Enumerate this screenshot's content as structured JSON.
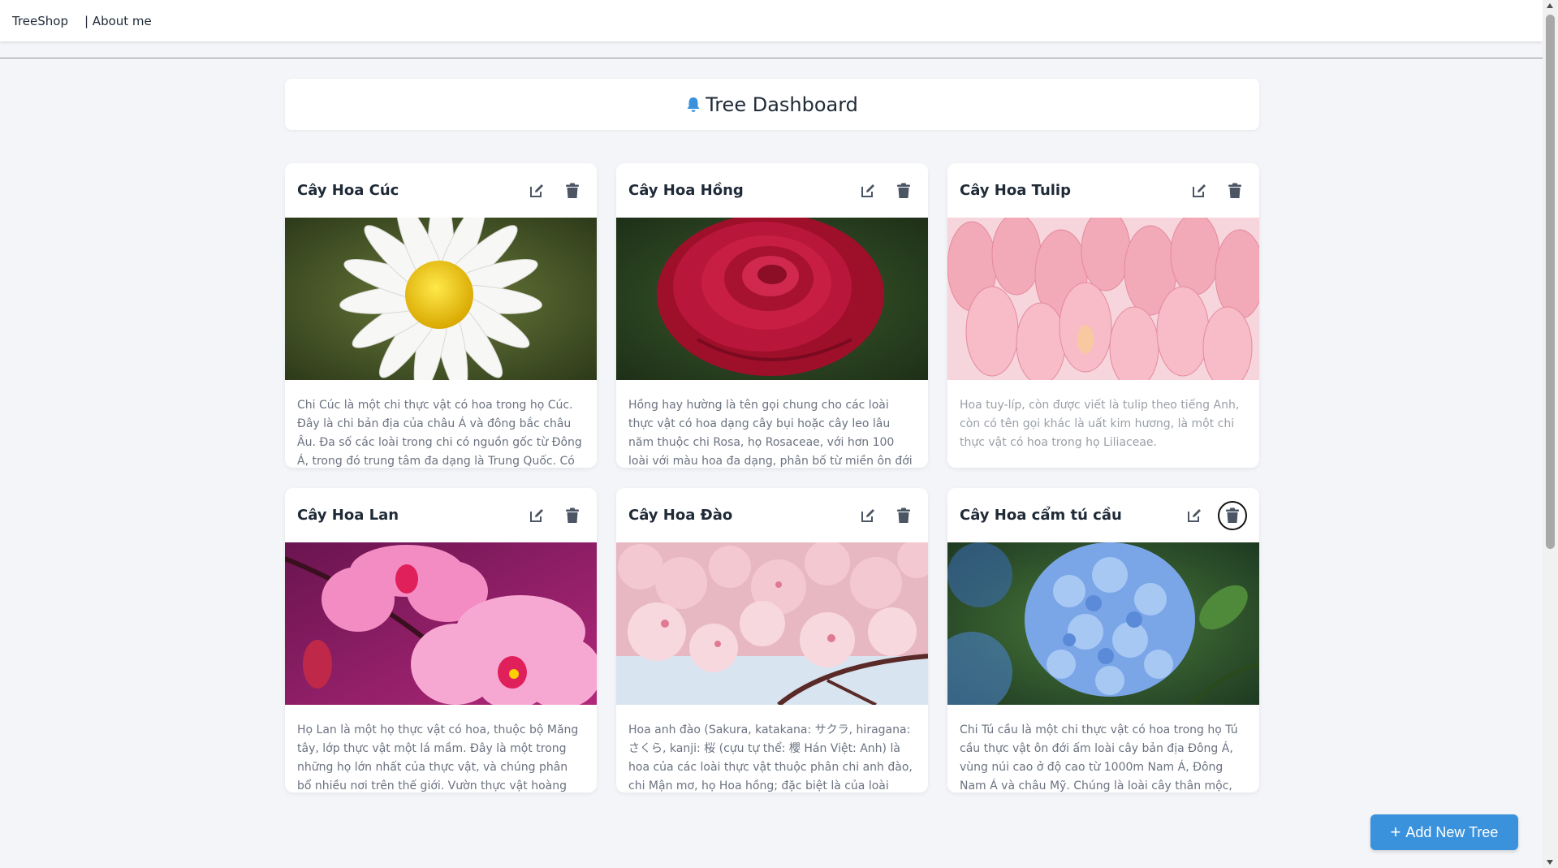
{
  "navbar": {
    "brand": "TreeShop",
    "about": "| About me"
  },
  "dashboard": {
    "title": "Tree Dashboard",
    "title_icon": "bell-icon"
  },
  "cards": [
    {
      "title": "Cây Hoa Cúc",
      "image": "white-daisy",
      "description": "Chi Cúc là một chi thực vật có hoa trong họ Cúc. Đây là chi bản địa của châu Á và đông bắc châu Âu. Đa số các loài trong chi có nguồn gốc từ Đông Á, trong đó trung tâm đa dạng là Trung Quốc. Có"
    },
    {
      "title": "Cây Hoa Hồng",
      "image": "red-rose",
      "description": "Hồng hay hường là tên gọi chung cho các loài thực vật có hoa dạng cây bụi hoặc cây leo lâu năm thuộc chi Rosa, họ Rosaceae, với hơn 100 loài với màu hoa đa dạng, phân bố từ miền ôn đới đến nhiệt đới. Các"
    },
    {
      "title": "Cây Hoa Tulip",
      "image": "pink-tulips",
      "description": "Hoa tuy-líp, còn được viết là tulip theo tiếng Anh, còn có tên gọi khác là uất kim hương, là một chi thực vật có hoa trong họ Liliaceae."
    },
    {
      "title": "Cây Hoa Lan",
      "image": "pink-orchid",
      "description": "Họ Lan là một họ thực vật có hoa, thuộc bộ Măng tây, lớp thực vật một lá mầm. Đây là một trong những họ lớn nhất của thực vật, và chúng phân bổ nhiều nơi trên thế giới. Vườn thực vật hoàng gia"
    },
    {
      "title": "Cây Hoa Đào",
      "image": "cherry-blossom",
      "description": "Hoa anh đào (Sakura, katakana: サクラ, hiragana: さくら, kanji: 桜 (cựu tự thể: 櫻 Hán Việt: Anh) là hoa của các loài thực vật thuộc phân chi anh đào, chi Mận mơ, họ Hoa hồng; đặc biệt là của loài Prunus"
    },
    {
      "title": "Cây Hoa cẩm tú cầu",
      "image": "blue-hydrangea",
      "description": "Chi Tú cầu là một chi thực vật có hoa trong họ Tú cầu thực vật ôn đới ấm loài cây bản địa Đông Á, vùng núi cao ở độ cao từ 1000m Nam Á, Đông Nam Á và châu Mỹ. Chúng là loài cây thân mộc, hoa vô"
    }
  ],
  "actions": {
    "edit_icon": "edit-icon",
    "delete_icon": "trash-icon"
  },
  "add_button": {
    "plus": "+",
    "label": "Add New Tree"
  },
  "colors": {
    "accent": "#3a92dc",
    "background": "#f3f5f8",
    "icon": "#4b5563"
  }
}
